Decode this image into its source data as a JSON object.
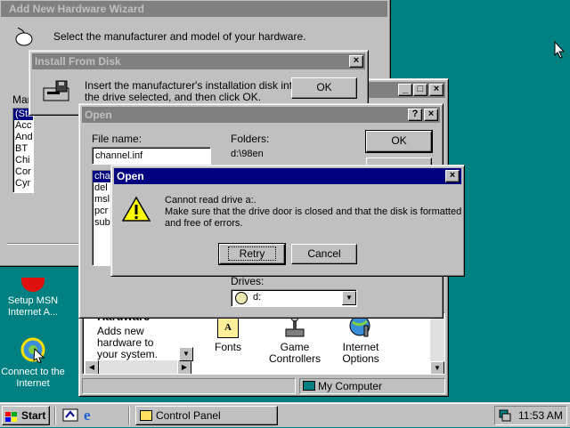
{
  "desktop": {
    "icons": [
      {
        "label": "Setup MSN Internet A..."
      },
      {
        "label": "Connect to the Internet"
      }
    ]
  },
  "wizard": {
    "title": "Add New Hardware Wizard",
    "instruction": "Select the manufacturer and model of your hardware.",
    "manufacturers_label": "Man",
    "manufacturers": [
      "(Sta",
      "Acc",
      "And",
      "BT",
      "Chi",
      "Cor",
      "Cyr"
    ]
  },
  "install_disk": {
    "title": "Install From Disk",
    "message_line1": "Insert the manufacturer's installation disk into",
    "message_line2": "the drive selected, and then click OK.",
    "ok_label": "OK"
  },
  "control_panel": {
    "title": "Control Panel",
    "hardware_title": "Hardware",
    "hardware_desc_l1": "Adds new",
    "hardware_desc_l2": "hardware to",
    "hardware_desc_l3": "your system.",
    "icons": [
      {
        "label": "Fonts"
      },
      {
        "label": "Game Controllers"
      },
      {
        "label": "Internet Options"
      }
    ],
    "status": "My Computer"
  },
  "open_dialog": {
    "title": "Open",
    "help_label": "?",
    "filename_label": "File name:",
    "filename_value": "channel.inf",
    "folders_label": "Folders:",
    "folders_path": "d:\\98en",
    "files": [
      "cha",
      "del",
      "msl",
      "pcr",
      "sub"
    ],
    "drives_label": "Drives:",
    "drive_value": "d:",
    "ok_label": "OK"
  },
  "error_dialog": {
    "title": "Open",
    "message_line1": "Cannot read drive a:.",
    "message_line2": "Make sure that the drive door is closed and that the disk is formatted",
    "message_line3": "and free of errors.",
    "retry_label": "Retry",
    "cancel_label": "Cancel"
  },
  "taskbar": {
    "start_label": "Start",
    "tasks": [
      {
        "label": "Control Panel"
      }
    ],
    "clock": "11:53 AM"
  },
  "colors": {
    "desktop": "#008080",
    "active_title": "#000080",
    "inactive_title": "#808080",
    "face": "#c0c0c0"
  }
}
